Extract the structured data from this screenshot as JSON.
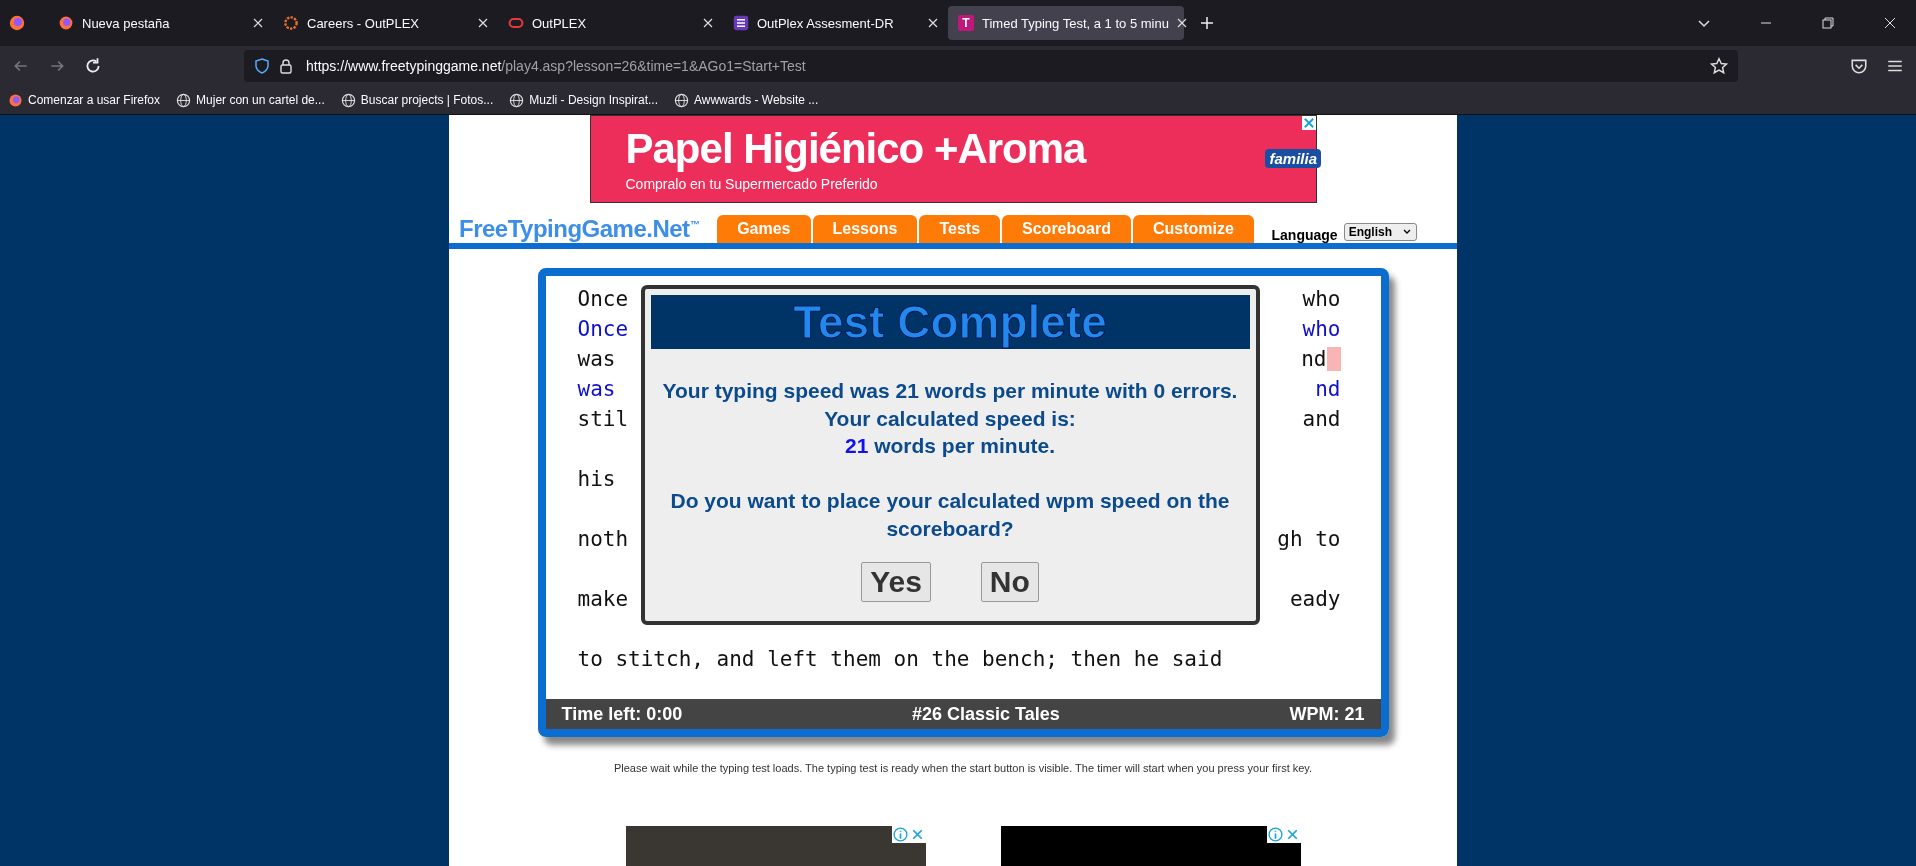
{
  "browser": {
    "tabs": [
      {
        "title": "Nueva pestaña",
        "selected": false
      },
      {
        "title": "Careers - OutPLEX",
        "selected": false
      },
      {
        "title": "OutPLEX",
        "selected": false
      },
      {
        "title": "OutPlex Assesment-DR",
        "selected": false
      },
      {
        "title": "Timed Typing Test, a 1 to 5 minu",
        "selected": true
      }
    ],
    "tab_icon_letter": "T",
    "url_host": "https://www.freetypinggame.net",
    "url_path": "/play4.asp?lesson=26&time=1&AGo1=Start+Test",
    "bookmarks": [
      "Comenzar a usar Firefox",
      "Mujer con un cartel de...",
      "Buscar projects | Fotos...",
      "Muzli - Design Inspirat...",
      "Awwwards - Website ..."
    ]
  },
  "ad": {
    "headline": "Papel Higiénico +Aroma",
    "subline": "Compralo en tu Supermercado Preferido",
    "brand": "familia"
  },
  "site": {
    "logo": "FreeTypingGame.Net",
    "logo_mark": "™",
    "nav": [
      "Games",
      "Lessons",
      "Tests",
      "Scoreboard",
      "Customize"
    ],
    "language_label": "Language",
    "language_value": "English"
  },
  "typing": {
    "lines": [
      {
        "left": "Once",
        "right": "who",
        "kind": "source"
      },
      {
        "left": "Once",
        "right": "who",
        "kind": "typed"
      },
      {
        "left": "was",
        "right": "nd",
        "kind": "source",
        "cursor": true
      },
      {
        "left": "was",
        "right": "nd",
        "kind": "typed"
      },
      {
        "left": "stil",
        "right": "and",
        "kind": "source"
      },
      {
        "left": "his",
        "kind": "gap"
      },
      {
        "left": "noth",
        "right": "gh to",
        "kind": "gap"
      },
      {
        "left": "make",
        "right": "eady",
        "kind": "gap"
      },
      {
        "left": "to stitch, and left them on the bench; then he said",
        "kind": "gap"
      }
    ],
    "status": {
      "time_left": "Time left: 0:00",
      "lesson": "#26 Classic Tales",
      "wpm": "WPM: 21"
    }
  },
  "dialog": {
    "title": "Test Complete",
    "message": "Your typing speed was 21 words per minute with 0 errors. Your calculated speed is:",
    "speed_value": "21",
    "speed_unit": "words per minute.",
    "question": "Do you want to place your calculated wpm speed on the scoreboard?",
    "buttons": [
      "Yes",
      "No"
    ]
  },
  "note": "Please wait while the typing test loads. The typing test is ready when the start button is visible. The timer will start when you press your first key."
}
